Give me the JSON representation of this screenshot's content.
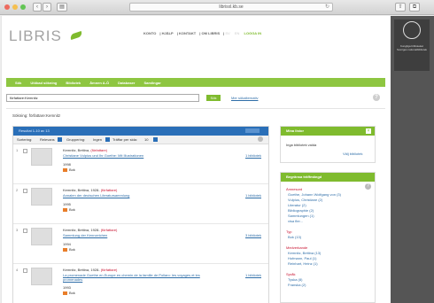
{
  "browser": {
    "url": "librisxl.kb.se",
    "url_display": "librisxl.kb.se",
    "back_label": "‹",
    "forward_label": "›",
    "reload_label": "↻"
  },
  "header": {
    "logo_text": "LIBRIS",
    "links": [
      "KONTO",
      "HJÄLP",
      "KONTAKT",
      "OM LIBRIS"
    ],
    "languages": [
      "SV",
      "EN"
    ],
    "login_label": "LOGGA IN"
  },
  "nav": {
    "items": [
      "Sök",
      "Utökad sökning",
      "Bibliotek",
      "Ämnen A-Ö",
      "Databaser",
      "Samlingar"
    ]
  },
  "search": {
    "value": "författare:Kemnitz",
    "button_label": "Sök",
    "advanced_label": "Mer sökalternativ",
    "info_text": "Sökning: författare:Kemnitz"
  },
  "results": {
    "header_text": "Resultat 1-10 av 13",
    "sort_label": "Sortering:",
    "sort_value": "Relevans",
    "group_label": "Gruppering:",
    "group_value": "Ingen",
    "filter_label": "Träffar per sida:",
    "filter_value": "10",
    "records": [
      {
        "num": "1",
        "author": "Kemnitz, Bettina,",
        "role": "(författare)",
        "title": "Christiane Vulpius und Ihr Goethe: Mit Illustrationen",
        "year": "1998",
        "type": "Bok",
        "libraries": "1 bibliotek"
      },
      {
        "num": "2",
        "author": "Kemnitz, Bettina, 1928-",
        "role": "(författare)",
        "title": "Annalen der deutschen Literatursammlung",
        "year": "1995",
        "type": "Bok",
        "libraries": "1 bibliotek"
      },
      {
        "num": "3",
        "author": "Kemnitz, Bettina, 1928-",
        "role": "(författare)",
        "title": "Sammlung der Kennzeichen",
        "year": "1994",
        "type": "Bok",
        "libraries": "3 bibliotek"
      },
      {
        "num": "4",
        "author": "Kemnitz, Bettina, 1928-",
        "role": "(författare)",
        "title": "La promenade Goethe en Europe en chemin de la famille de Pollaro: les voyages et les promenades",
        "year": "1993",
        "type": "Bok",
        "libraries": "1 bibliotek"
      }
    ]
  },
  "panels": {
    "my_list": {
      "title": "Mina listor",
      "body": "Inga bibliotek valda",
      "link": "Välj bibliotek"
    },
    "refine": {
      "title": "Begränsa träffmängd",
      "groups": [
        {
          "heading": "Ämnesord",
          "items": [
            "Goethe, Johann Wolfgang von (3)",
            "Vulpius, Christiane (2)",
            "Literatur (2)",
            "Bibliographie (2)",
            "Sammlungen (1)",
            "visa fler..."
          ]
        },
        {
          "heading": "Typ",
          "items": [
            "Bok (13)"
          ]
        },
        {
          "heading": "Medverkande",
          "items": [
            "Kemnitz, Bettina (13)",
            "Hofmann, Paul (1)",
            "Reinhart, Heinz (1)"
          ]
        },
        {
          "heading": "Språk",
          "items": [
            "Tyska (8)",
            "Franska (2)"
          ]
        }
      ]
    }
  },
  "sidebar_badge": {
    "text": "Kungliga biblioteket Sveriges nationalbibliotek"
  },
  "colors": {
    "brand_green": "#7fbb2e",
    "result_blue": "#2a6fb8",
    "link_blue": "#2f6ea8",
    "accent_red": "#c8102e"
  }
}
